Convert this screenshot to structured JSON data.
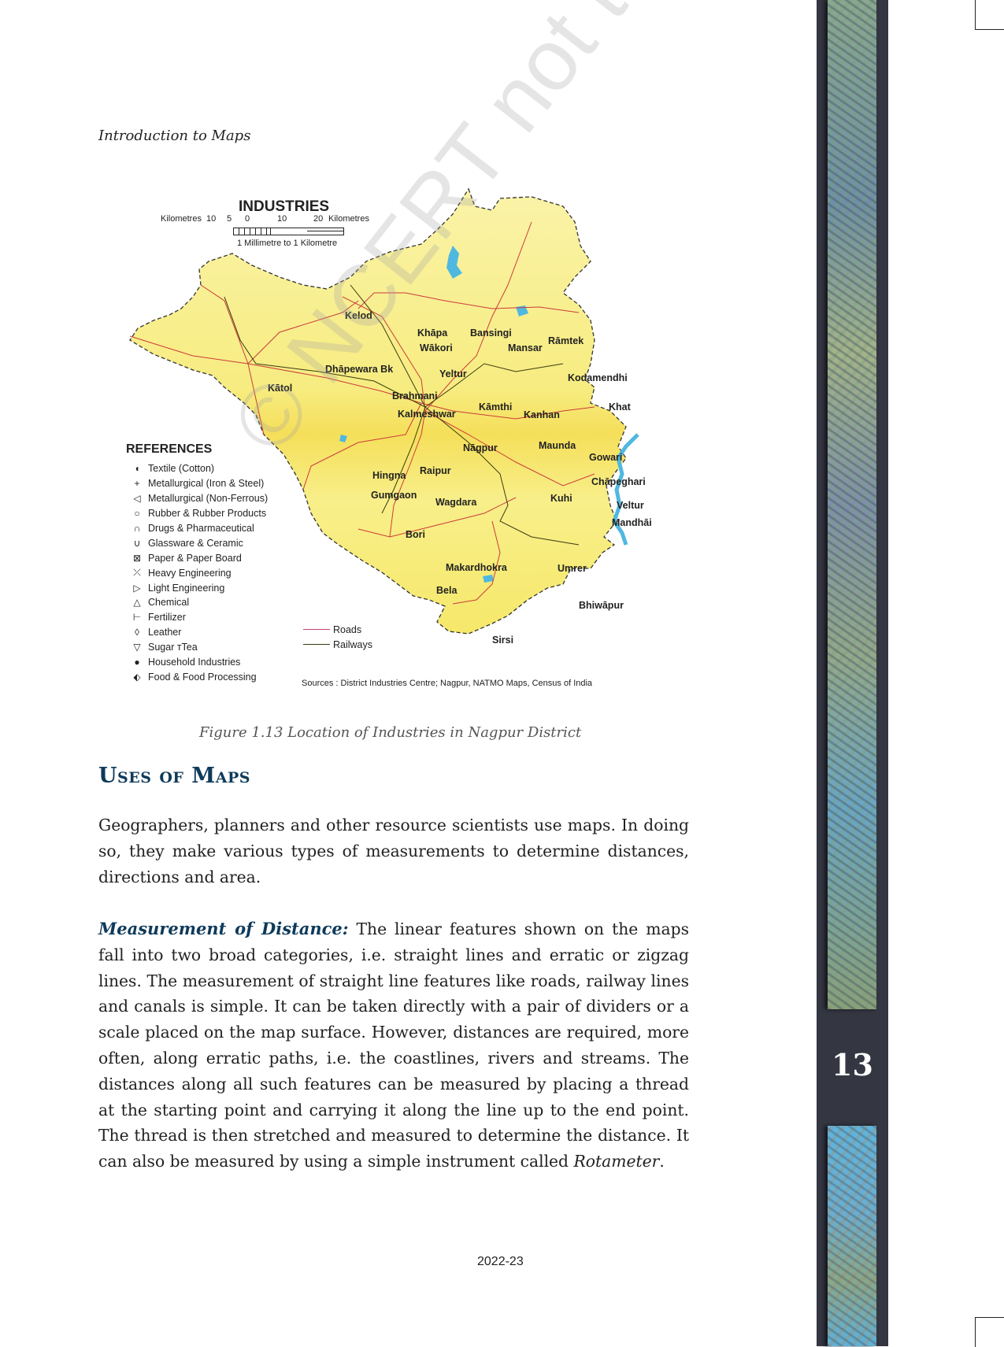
{
  "running_head": "Introduction to Maps",
  "figure": {
    "map_title": "INDUSTRIES",
    "scale": {
      "left_label": "Kilometres",
      "ticks": [
        "10",
        "5",
        "0",
        "10",
        "20"
      ],
      "right_label": "Kilometres",
      "ratio_text": "1 Millimetre to 1 Kilometre"
    },
    "references": {
      "title": "REFERENCES",
      "items": [
        {
          "symbol": "textile-icon",
          "glyph": "◖",
          "label": "Textile (Cotton)"
        },
        {
          "symbol": "plus-icon",
          "glyph": "+",
          "label": "Metallurgical (Iron & Steel)"
        },
        {
          "symbol": "left-triangle-icon",
          "glyph": "◁",
          "label": "Metallurgical (Non-Ferrous)"
        },
        {
          "symbol": "circle-icon",
          "glyph": "○",
          "label": "Rubber & Rubber Products"
        },
        {
          "symbol": "arch-icon",
          "glyph": "∩",
          "label": "Drugs & Pharmaceutical"
        },
        {
          "symbol": "cup-icon",
          "glyph": "∪",
          "label": "Glassware & Ceramic"
        },
        {
          "symbol": "crossed-box-icon",
          "glyph": "⊠",
          "label": "Paper & Paper Board"
        },
        {
          "symbol": "heavy-engineering-icon",
          "glyph": "⤫",
          "label": "Heavy Engineering"
        },
        {
          "symbol": "right-triangle-icon",
          "glyph": "▷",
          "label": "Light Engineering"
        },
        {
          "symbol": "triangle-icon",
          "glyph": "△",
          "label": "Chemical"
        },
        {
          "symbol": "fertilizer-icon",
          "glyph": "⊢",
          "label": "Fertilizer"
        },
        {
          "symbol": "diamond-icon",
          "glyph": "◊",
          "label": "Leather"
        },
        {
          "symbol": "down-triangle-icon",
          "glyph": "▽",
          "label": "Sugar ᴛTea"
        },
        {
          "symbol": "dot-icon",
          "glyph": "●",
          "label": "Household Industries"
        },
        {
          "symbol": "food-processing-icon",
          "glyph": "⬖",
          "label": "Food & Food Processing"
        }
      ]
    },
    "line_legend": [
      {
        "label": "Roads",
        "color": "#c8407a"
      },
      {
        "label": "Railways",
        "color": "#3a3a10"
      }
    ],
    "places": [
      "Kelod",
      "Khāpa",
      "Bansingi",
      "Wākori",
      "Mansar",
      "Rāmtek",
      "Dhāpewara Bk",
      "Yeltur",
      "Kodamendhi",
      "Kātol",
      "Brahmani",
      "Kāmthi",
      "Khat",
      "Kalmeshwar",
      "Kanhan",
      "Maunda",
      "Nāgpur",
      "Gowari",
      "Raipur",
      "Hingna",
      "Chāpeghari",
      "Gumgaon",
      "Wagdara",
      "Kuhi",
      "Veltur",
      "Mandhāi",
      "Bori",
      "Makardhokra",
      "Umrer",
      "Bela",
      "Bhiwāpur",
      "Sirsi"
    ],
    "sources": "Sources : District Industries Centre; Nagpur, NATMO Maps, Census of India",
    "colors": {
      "land": "#f7ee86",
      "water": "#4fb8e0",
      "road": "#cc3b3b",
      "railway": "#3a3a10"
    }
  },
  "caption": "Figure 1.13 Location of Industries in Nagpur District",
  "section_title": "Uses of Maps",
  "paragraphs": {
    "p1": "Geographers, planners and other resource scientists use maps. In doing so, they make various types of measurements to determine distances, directions and area.",
    "p2_lead": "Measurement of Distance:",
    "p2_body": " The linear features shown on the maps fall into two broad categories, i.e. straight lines and erratic or zigzag lines. The measurement of straight line features like roads, railway lines and canals is simple. It can be taken directly with a pair of dividers or a scale placed on the map surface. However, distances are required, more often, along erratic paths, i.e. the coastlines, rivers and streams. The distances along all such features can be measured by placing a thread at the starting point and carrying it along the line up to the end point. The thread is then stretched and measured to determine the distance. It can also be measured by using a simple instrument called ",
    "p2_em": "Rotameter",
    "p2_end": "."
  },
  "watermark": "© NCERT not to be republished",
  "footer_year": "2022-23",
  "sidebar": {
    "page_number": "13",
    "color": "#343642"
  }
}
